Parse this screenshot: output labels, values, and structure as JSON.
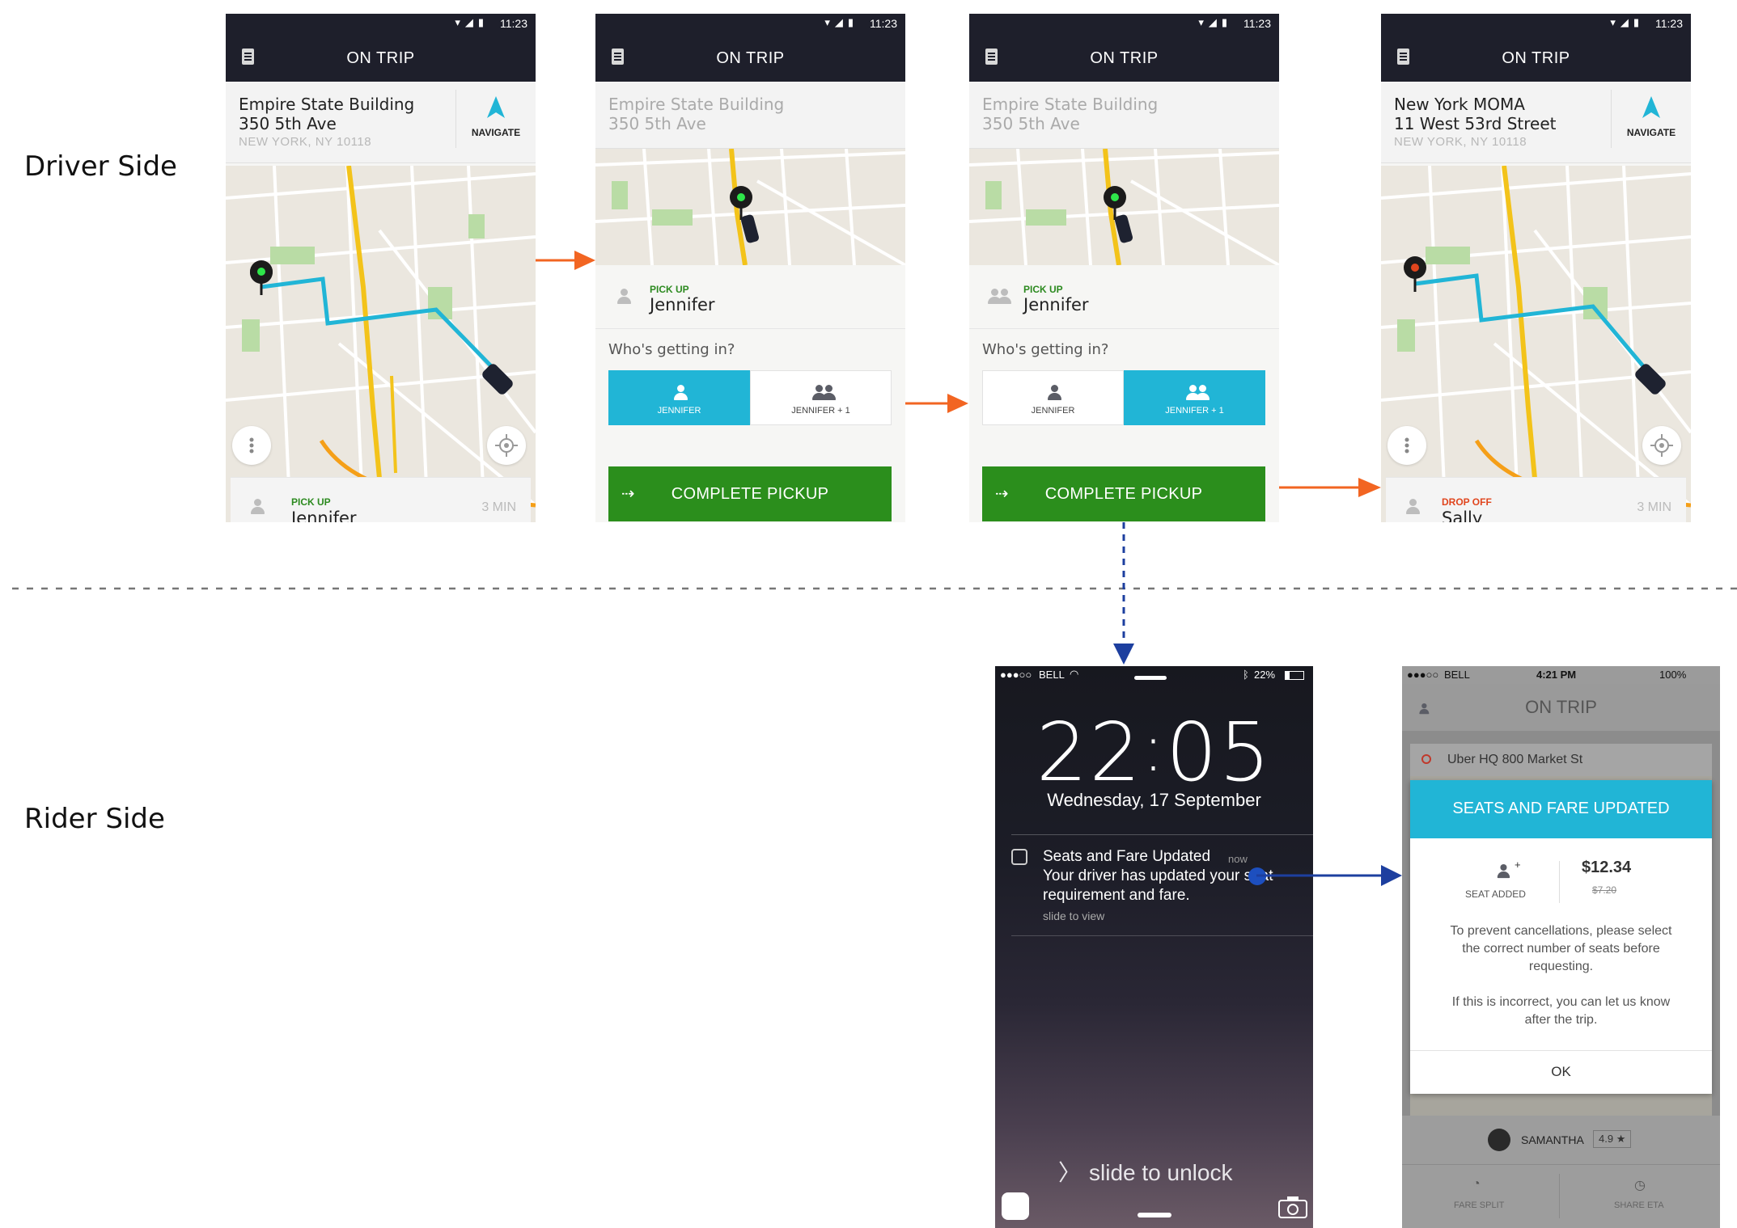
{
  "labels": {
    "driver_side": "Driver Side",
    "rider_side": "Rider Side"
  },
  "colors": {
    "teal": "#21b5d6",
    "green": "#2b8e1c",
    "orange": "#f26522",
    "blue": "#1d3f9f",
    "appbar": "#1e1f2b"
  },
  "driver_screens": {
    "status_time": "11:23",
    "title": "ON TRIP",
    "screen1": {
      "addr_line1": "Empire State Building",
      "addr_line2": "350 5th Ave",
      "addr_line3": "NEW YORK, NY 10118",
      "navigate_label": "NAVIGATE",
      "pick_tag": "PICK UP",
      "pick_name": "Jennifer",
      "eta": "3 MIN"
    },
    "screen2": {
      "addr_line1": "Empire State Building",
      "addr_line2": "350 5th Ave",
      "pick_tag": "PICK UP",
      "pick_name": "Jennifer",
      "question": "Who's getting in?",
      "opt1": "JENNIFER",
      "opt2": "JENNIFER + 1",
      "button": "COMPLETE PICKUP"
    },
    "screen3": {
      "addr_line1": "Empire State Building",
      "addr_line2": "350 5th Ave",
      "pick_tag": "PICK UP",
      "pick_name": "Jennifer",
      "question": "Who's getting in?",
      "opt1": "JENNIFER",
      "opt2": "JENNIFER + 1",
      "button": "COMPLETE PICKUP"
    },
    "screen4": {
      "addr_line1": "New York MOMA",
      "addr_line2": "11 West 53rd Street",
      "addr_line3": "NEW YORK, NY 10118",
      "navigate_label": "NAVIGATE",
      "drop_tag": "DROP OFF",
      "drop_name": "Sally",
      "eta": "3 MIN"
    }
  },
  "lock_screen": {
    "carrier": "BELL",
    "battery": "22%",
    "time_h": "22",
    "time_m": "05",
    "date": "Wednesday, 17 September",
    "notif_title": "Seats and Fare Updated",
    "notif_when": "now",
    "notif_body1": "Your driver has updated your seat",
    "notif_body2": "requirement and fare.",
    "notif_hint": "slide to view",
    "unlock": "slide to unlock"
  },
  "rider_app": {
    "carrier": "BELL",
    "time": "4:21 PM",
    "battery": "100%",
    "title": "ON TRIP",
    "pickup_addr": "Uber HQ 800 Market St",
    "modal_title": "SEATS AND FARE UPDATED",
    "seat_added": "SEAT ADDED",
    "new_fare": "$12.34",
    "old_fare": "$7.20",
    "msg1": "To prevent cancellations, please select the correct number of seats before requesting.",
    "msg2": "If this is incorrect, you can let us know after the trip.",
    "ok": "OK",
    "driver_name": "SAMANTHA",
    "rating": "4.9",
    "fare_split": "FARE SPLIT",
    "share_eta": "SHARE ETA"
  }
}
